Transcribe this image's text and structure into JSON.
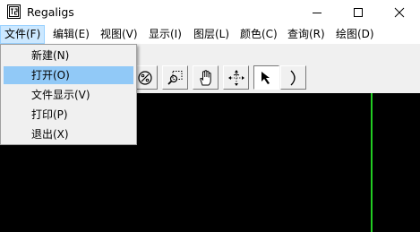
{
  "window": {
    "title": "Regaligs",
    "icon": "app-icon",
    "controls": [
      "minimize-icon",
      "maximize-icon",
      "close-icon"
    ]
  },
  "menubar": {
    "items": [
      {
        "label": "文件(F)",
        "active": true
      },
      {
        "label": "编辑(E)"
      },
      {
        "label": "视图(V)"
      },
      {
        "label": "显示(I)"
      },
      {
        "label": "图层(L)"
      },
      {
        "label": "颜色(C)"
      },
      {
        "label": "查询(R)"
      },
      {
        "label": "绘图(D)"
      }
    ]
  },
  "file_menu": {
    "items": [
      {
        "label": "新建(N)"
      },
      {
        "label": "打开(O)",
        "highlighted": true
      },
      {
        "label": "文件显示(V)"
      },
      {
        "label": "打印(P)"
      },
      {
        "label": "退出(X)"
      }
    ]
  },
  "toolbar": {
    "buttons": [
      {
        "icon": "zoom-percent-icon"
      },
      {
        "icon": "zoom-window-icon"
      },
      {
        "icon": "pan-hand-icon"
      },
      {
        "icon": "rotate-view-icon"
      },
      {
        "icon": "select-arrow-icon",
        "pressed": true
      },
      {
        "icon": "arc-icon"
      }
    ]
  },
  "canvas": {
    "background": "#000000",
    "line_color": "#22cc22"
  },
  "colors": {
    "menu_highlight": "#91c9f7",
    "menubar_active": "#cce8ff"
  }
}
